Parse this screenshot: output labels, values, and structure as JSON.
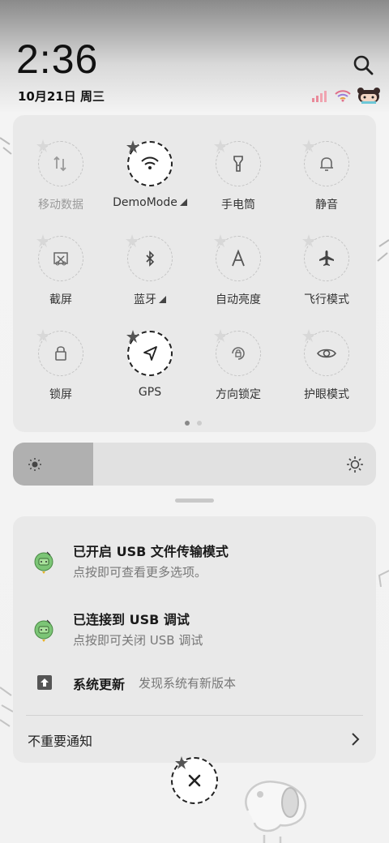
{
  "status": {
    "time": "2:36",
    "date": "10月21日 周三",
    "icons": [
      "signal-icon",
      "wifi-icon",
      "character-icon"
    ]
  },
  "quick_settings": {
    "tiles": [
      {
        "name": "mobile-data",
        "label": "移动数据",
        "icon": "mobile-data-icon",
        "active": false,
        "dim": true
      },
      {
        "name": "wifi",
        "label": "DemoMode",
        "icon": "wifi-icon",
        "active": true,
        "dim": false,
        "expand": true
      },
      {
        "name": "flashlight",
        "label": "手电筒",
        "icon": "flashlight-icon",
        "active": false,
        "dim": false
      },
      {
        "name": "silent",
        "label": "静音",
        "icon": "bell-icon",
        "active": false,
        "dim": false
      },
      {
        "name": "screenshot",
        "label": "截屏",
        "icon": "screenshot-icon",
        "active": false,
        "dim": false
      },
      {
        "name": "bluetooth",
        "label": "蓝牙",
        "icon": "bluetooth-icon",
        "active": false,
        "dim": false,
        "expand": true
      },
      {
        "name": "auto-brightness",
        "label": "自动亮度",
        "icon": "auto-brightness-icon",
        "active": false,
        "dim": false
      },
      {
        "name": "airplane",
        "label": "飞行模式",
        "icon": "airplane-icon",
        "active": false,
        "dim": false
      },
      {
        "name": "lock-screen",
        "label": "锁屏",
        "icon": "lock-icon",
        "active": false,
        "dim": false
      },
      {
        "name": "gps",
        "label": "GPS",
        "icon": "location-arrow-icon",
        "active": true,
        "dim": false
      },
      {
        "name": "rotation-lock",
        "label": "方向锁定",
        "icon": "rotation-lock-icon",
        "active": false,
        "dim": false
      },
      {
        "name": "eye-care",
        "label": "护眼模式",
        "icon": "eye-icon",
        "active": false,
        "dim": false
      }
    ],
    "page_count": 2,
    "current_page": 1
  },
  "brightness": {
    "level": 0.22
  },
  "notifications": [
    {
      "title": "已开启 USB 文件传输模式",
      "text": "点按即可查看更多选项。",
      "icon": "android-debug-icon"
    },
    {
      "title": "已连接到 USB 调试",
      "text": "点按即可关闭 USB 调试",
      "icon": "android-debug-icon"
    },
    {
      "title": "系统更新",
      "text": "发现系统有新版本",
      "icon": "upload-icon"
    }
  ],
  "unimportant_label": "不重要通知",
  "colors": {
    "panel": "#e9e9e9",
    "active_tile": "#ffffff",
    "notif_icon_green": "#7cc576"
  }
}
